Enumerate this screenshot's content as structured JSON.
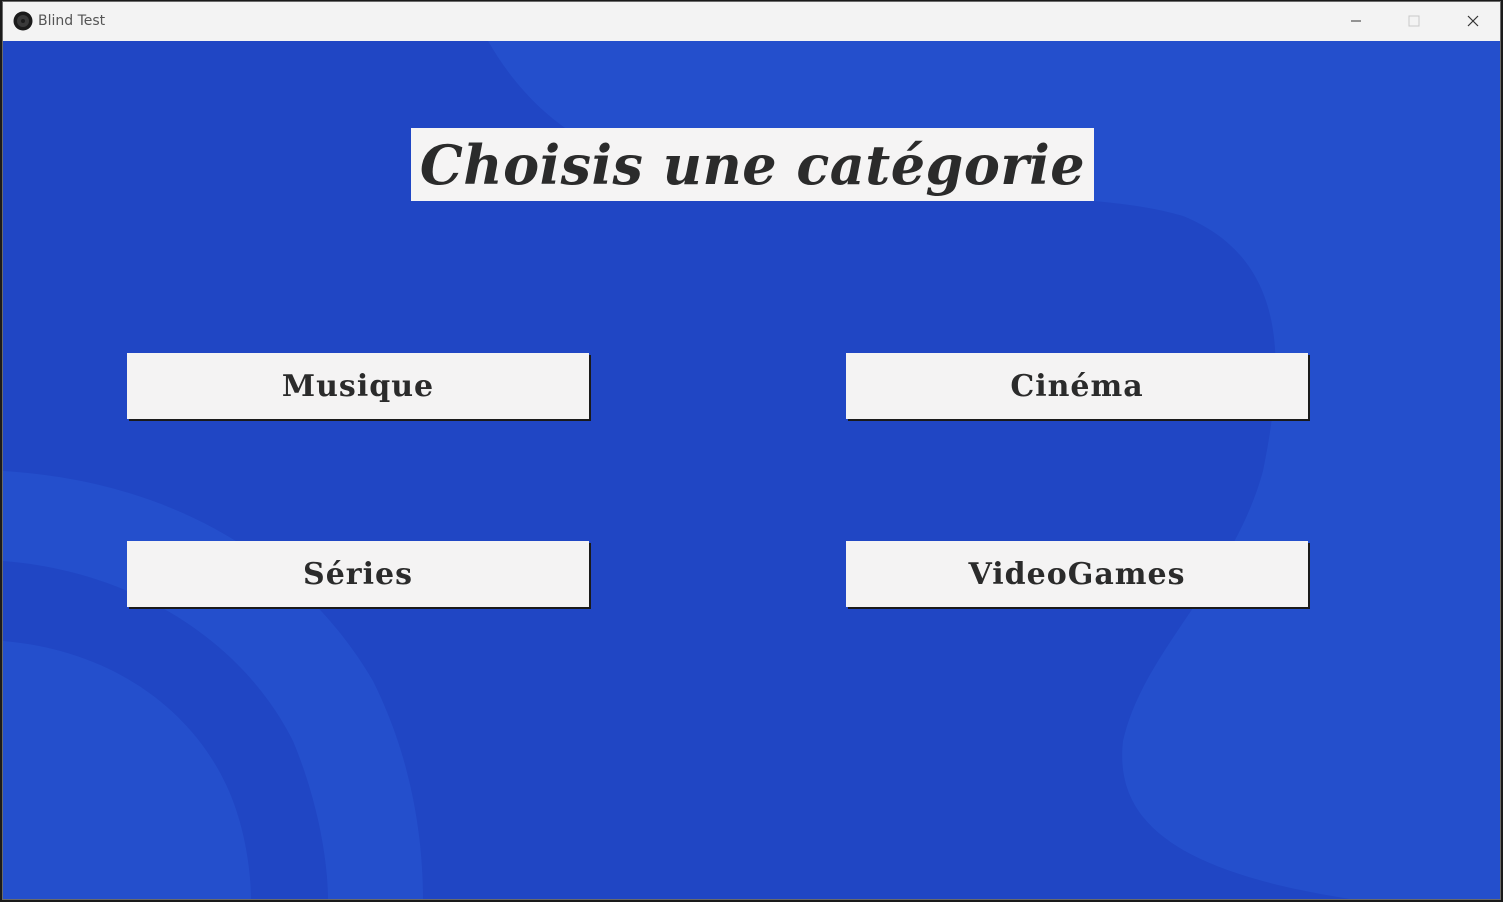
{
  "window": {
    "title": "Blind Test",
    "app_icon": "blind-test-logo-icon",
    "controls": {
      "minimize_icon": "minimize-icon",
      "maximize_icon": "maximize-icon",
      "close_icon": "close-icon"
    }
  },
  "main": {
    "heading": "Choisis une catégorie",
    "categories": [
      {
        "label": "Musique"
      },
      {
        "label": "Cinéma"
      },
      {
        "label": "Séries"
      },
      {
        "label": "VideoGames"
      }
    ]
  },
  "colors": {
    "background": "#2046c4",
    "background_blob": "#244fcc",
    "panel": "#f4f3f3",
    "text": "#2b2b2b",
    "titlebar": "#f3f3f3"
  }
}
